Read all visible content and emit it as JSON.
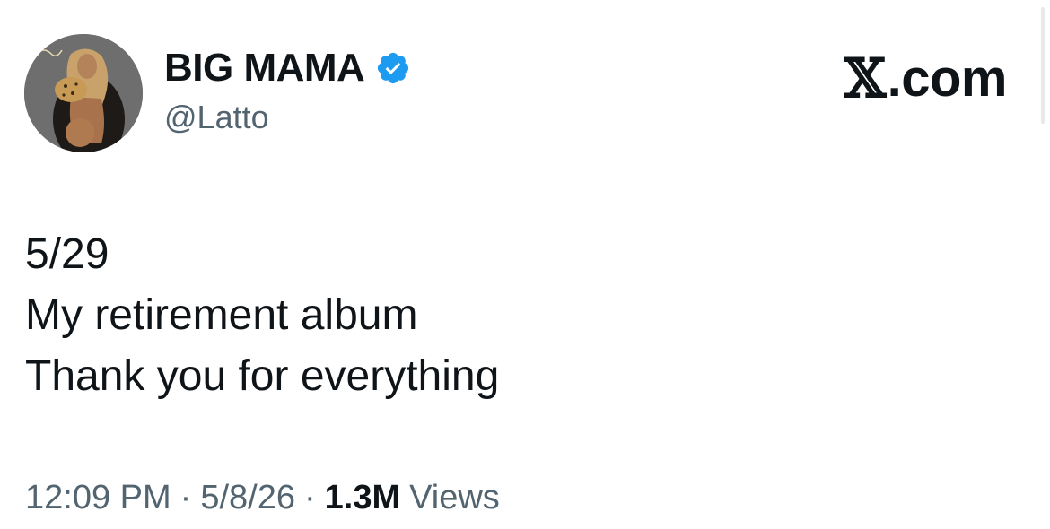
{
  "author": {
    "display_name": "BIG MAMA",
    "handle": "@Latto",
    "verified_color": "#1d9bf0",
    "avatar_icon": "profile-photo"
  },
  "brand": {
    "text": ".com",
    "icon": "x-logo"
  },
  "tweet": {
    "lines": [
      "5/29",
      "My retirement album",
      "Thank you for everything"
    ]
  },
  "meta": {
    "time": "12:09 PM",
    "separator": "·",
    "date": "5/8/26",
    "views_count": "1.3M",
    "views_label": "Views"
  },
  "colors": {
    "text_primary": "#0f1419",
    "text_secondary": "#536471",
    "accent": "#1d9bf0"
  }
}
